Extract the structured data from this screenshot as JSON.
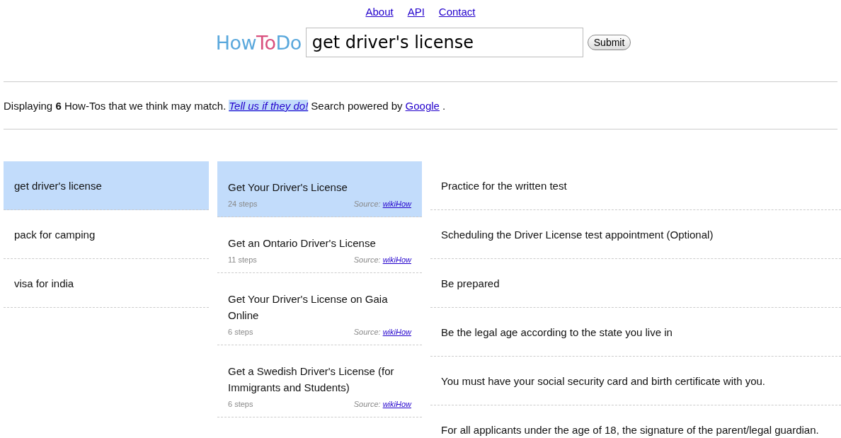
{
  "nav_links": [
    "About",
    "API",
    "Contact"
  ],
  "logo": [
    {
      "text": "How",
      "color": "#5aa8dc"
    },
    {
      "text": "To",
      "color": "#d9507e"
    },
    {
      "text": "Do",
      "color": "#5aa8dc"
    }
  ],
  "search": {
    "value": "get driver's license",
    "button": "Submit"
  },
  "summary": {
    "text": "Displaying **6** How-Tos that we think may match.",
    "feedback_link": "Tell us if they do!",
    "powered_text": "Search powered by",
    "powered_link": "Google",
    "end": "."
  },
  "queries": [
    {
      "label": "get driver's license",
      "selected": true
    },
    {
      "label": "pack for camping",
      "selected": false
    },
    {
      "label": "visa for india",
      "selected": false
    }
  ],
  "howtos": [
    {
      "title": "Get Your Driver's License",
      "steps": "24 steps",
      "source_label": "Source:",
      "source": "wikiHow",
      "selected": true
    },
    {
      "title": "Get an Ontario Driver's License",
      "steps": "11 steps",
      "source_label": "Source:",
      "source": "wikiHow",
      "selected": false
    },
    {
      "title": "Get Your Driver's License on Gaia Online",
      "steps": "6 steps",
      "source_label": "Source:",
      "source": "wikiHow",
      "selected": false
    },
    {
      "title": "Get a Swedish Driver's License (for Immigrants and Students)",
      "steps": "6 steps",
      "source_label": "Source:",
      "source": "wikiHow",
      "selected": false
    }
  ],
  "steps": [
    "Practice for the written test",
    "Scheduling the Driver License test appointment (Optional)",
    "Be prepared",
    "Be the legal age according to the state you live in",
    "You must have your social security card and birth certificate with you.",
    "For all applicants under the age of 18, the signature of the parent/legal guardian."
  ]
}
